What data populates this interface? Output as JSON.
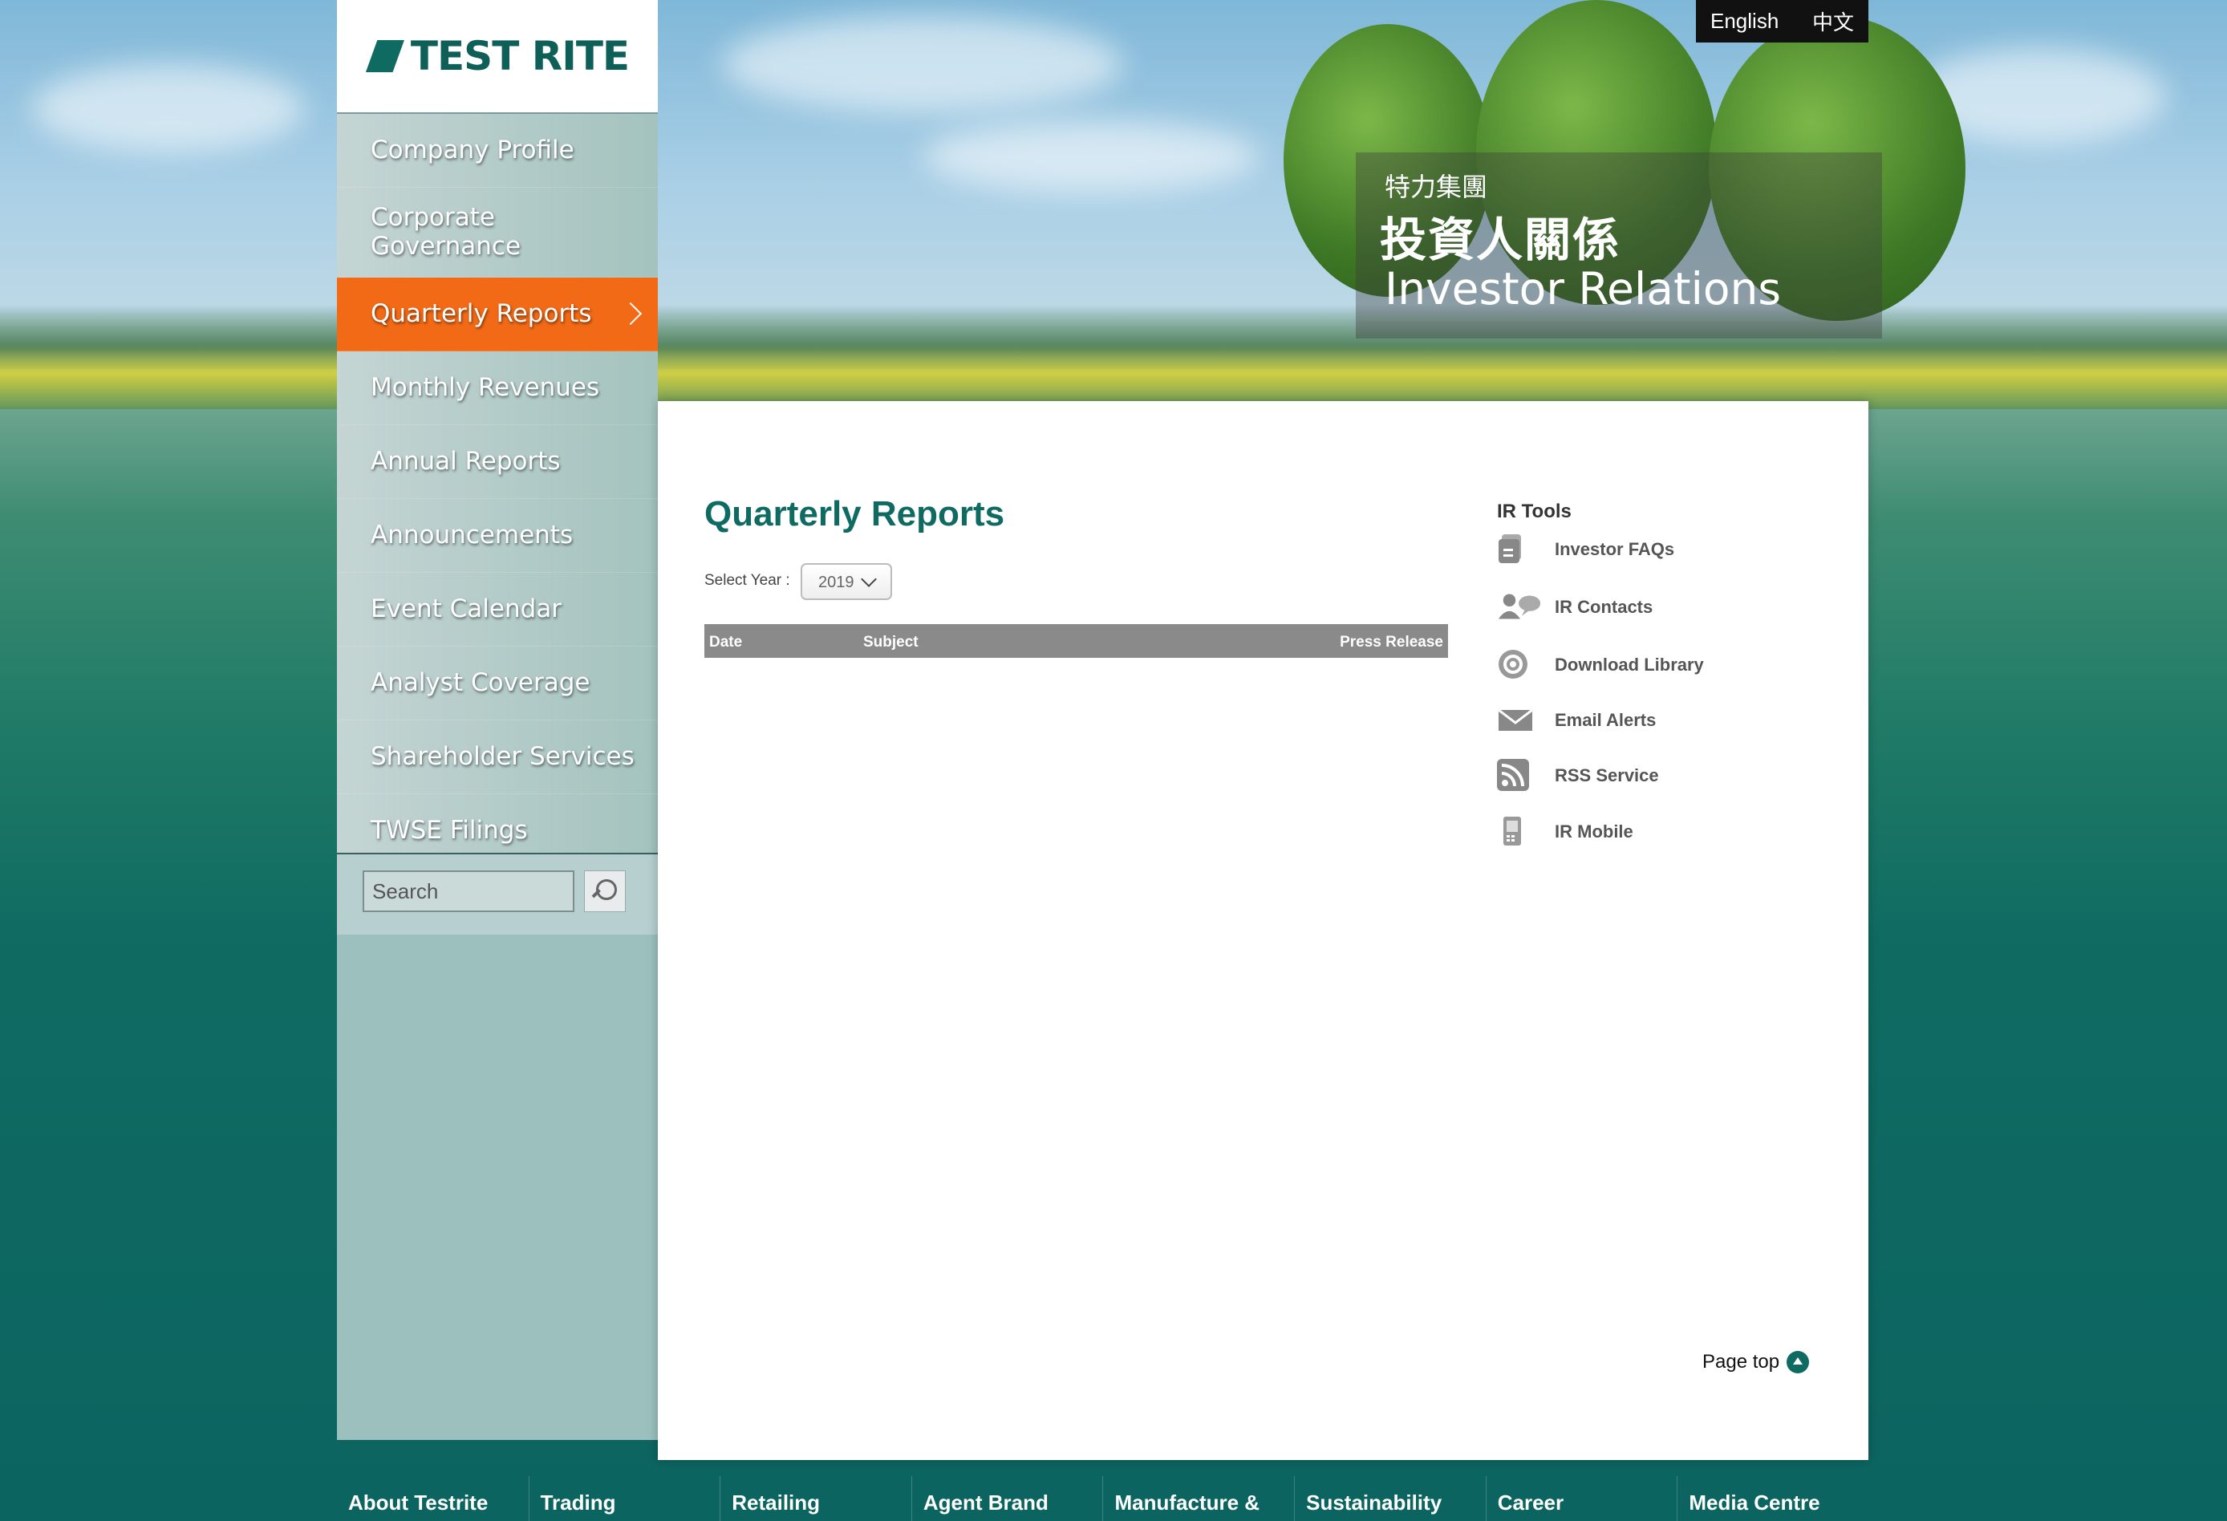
{
  "header": {
    "logo_text": "TEST RITE",
    "languages": [
      "English",
      "中文"
    ],
    "banner": {
      "small": "特力集團",
      "title_zh": "投資人關係",
      "title_en": "Investor Relations"
    }
  },
  "sidebar": {
    "items": [
      {
        "label": "Company Profile"
      },
      {
        "label": "Corporate Governance"
      },
      {
        "label": "Quarterly Reports"
      },
      {
        "label": "Monthly Revenues"
      },
      {
        "label": "Annual Reports"
      },
      {
        "label": "Announcements"
      },
      {
        "label": "Event Calendar"
      },
      {
        "label": "Analyst Coverage"
      },
      {
        "label": "Shareholder Services"
      },
      {
        "label": "TWSE Filings"
      }
    ],
    "active_index": 2,
    "search_placeholder": "Search"
  },
  "main": {
    "title": "Quarterly Reports",
    "select_year_label": "Select Year :",
    "selected_year": "2019",
    "table_headers": {
      "date": "Date",
      "subject": "Subject",
      "press_release": "Press Release"
    },
    "rows": []
  },
  "ir_tools": {
    "title": "IR Tools",
    "items": [
      {
        "label": "Investor FAQs",
        "icon": "document-icon"
      },
      {
        "label": "IR Contacts",
        "icon": "contacts-icon"
      },
      {
        "label": "Download Library",
        "icon": "download-library-icon"
      },
      {
        "label": "Email Alerts",
        "icon": "mail-icon"
      },
      {
        "label": "RSS Service",
        "icon": "rss-icon"
      },
      {
        "label": "IR Mobile",
        "icon": "mobile-icon"
      }
    ]
  },
  "page_top": "Page top",
  "footer": {
    "items": [
      "About Testrite",
      "Trading",
      "Retailing",
      "Agent Brand",
      "Manufacture &",
      "Sustainability",
      "Career",
      "Media Centre"
    ]
  },
  "colors": {
    "accent": "#f26a16",
    "brand": "#0f6b62",
    "sidebar": "#9bc0be"
  }
}
